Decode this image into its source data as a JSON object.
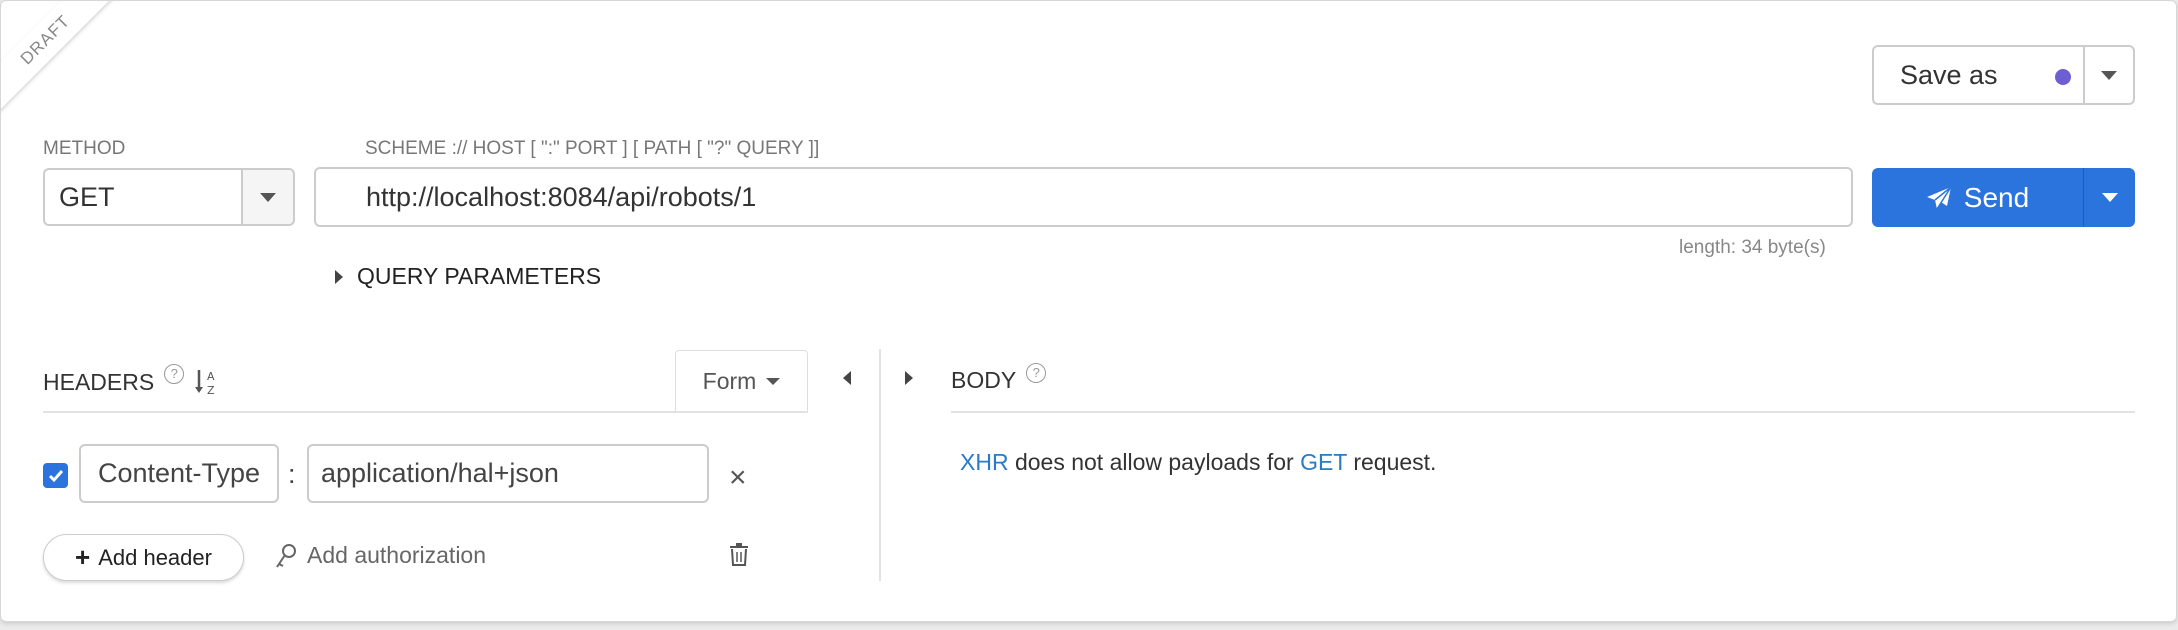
{
  "badge": {
    "draft": "DRAFT"
  },
  "save": {
    "label": "Save as",
    "dot_color": "#6e5dd4"
  },
  "method": {
    "label": "METHOD",
    "value": "GET"
  },
  "url": {
    "label": "SCHEME :// HOST [ \":\" PORT ] [ PATH [ \"?\" QUERY ]]",
    "value": "http://localhost:8084/api/robots/1",
    "length": "length: 34 byte(s)"
  },
  "send": {
    "label": "Send",
    "color": "#2b74dd"
  },
  "query_params": {
    "label": "QUERY PARAMETERS"
  },
  "headers": {
    "title": "HEADERS",
    "mode": "Form",
    "rows": [
      {
        "enabled": true,
        "name": "Content-Type",
        "separator": ":",
        "value": "application/hal+json"
      }
    ],
    "add_header": "Add header",
    "add_authorization": "Add authorization"
  },
  "body": {
    "title": "BODY",
    "msg_xhr": "XHR",
    "msg_mid": " does not allow payloads for ",
    "msg_get": "GET",
    "msg_end": " request."
  }
}
